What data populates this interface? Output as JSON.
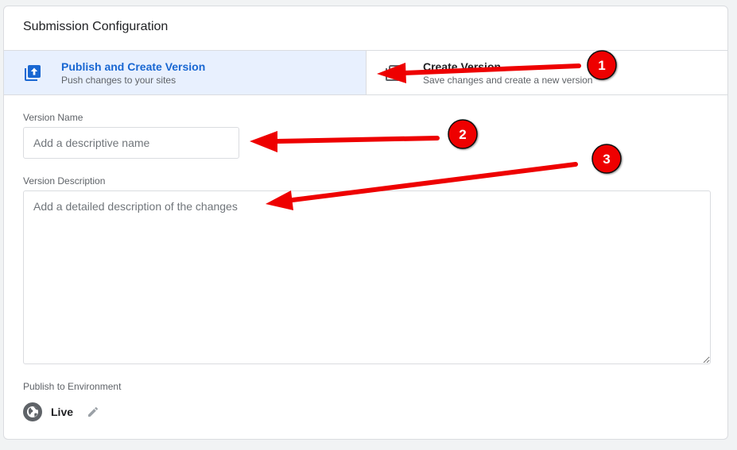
{
  "card": {
    "title": "Submission Configuration"
  },
  "submission_types": [
    {
      "label": "Publish and Create Version",
      "sub": "Push changes to your sites",
      "icon": "publish-icon",
      "selected": true
    },
    {
      "label": "Create Version",
      "sub": "Save changes and create a new version",
      "icon": "create-version-icon",
      "selected": false
    }
  ],
  "version_name": {
    "label": "Version Name",
    "placeholder": "Add a descriptive name",
    "value": ""
  },
  "version_description": {
    "label": "Version Description",
    "placeholder": "Add a detailed description of the changes",
    "value": ""
  },
  "environment": {
    "label": "Publish to Environment",
    "name": "Live",
    "icon": "globe-icon",
    "edit_icon": "pencil-icon"
  },
  "annotations": [
    {
      "number": "1"
    },
    {
      "number": "2"
    },
    {
      "number": "3"
    }
  ],
  "colors": {
    "accent": "#1967d2",
    "selected_bg": "#e8f0fe",
    "annotation_red": "#ee0000",
    "border": "#dadce0",
    "secondary_text": "#5f6368"
  }
}
